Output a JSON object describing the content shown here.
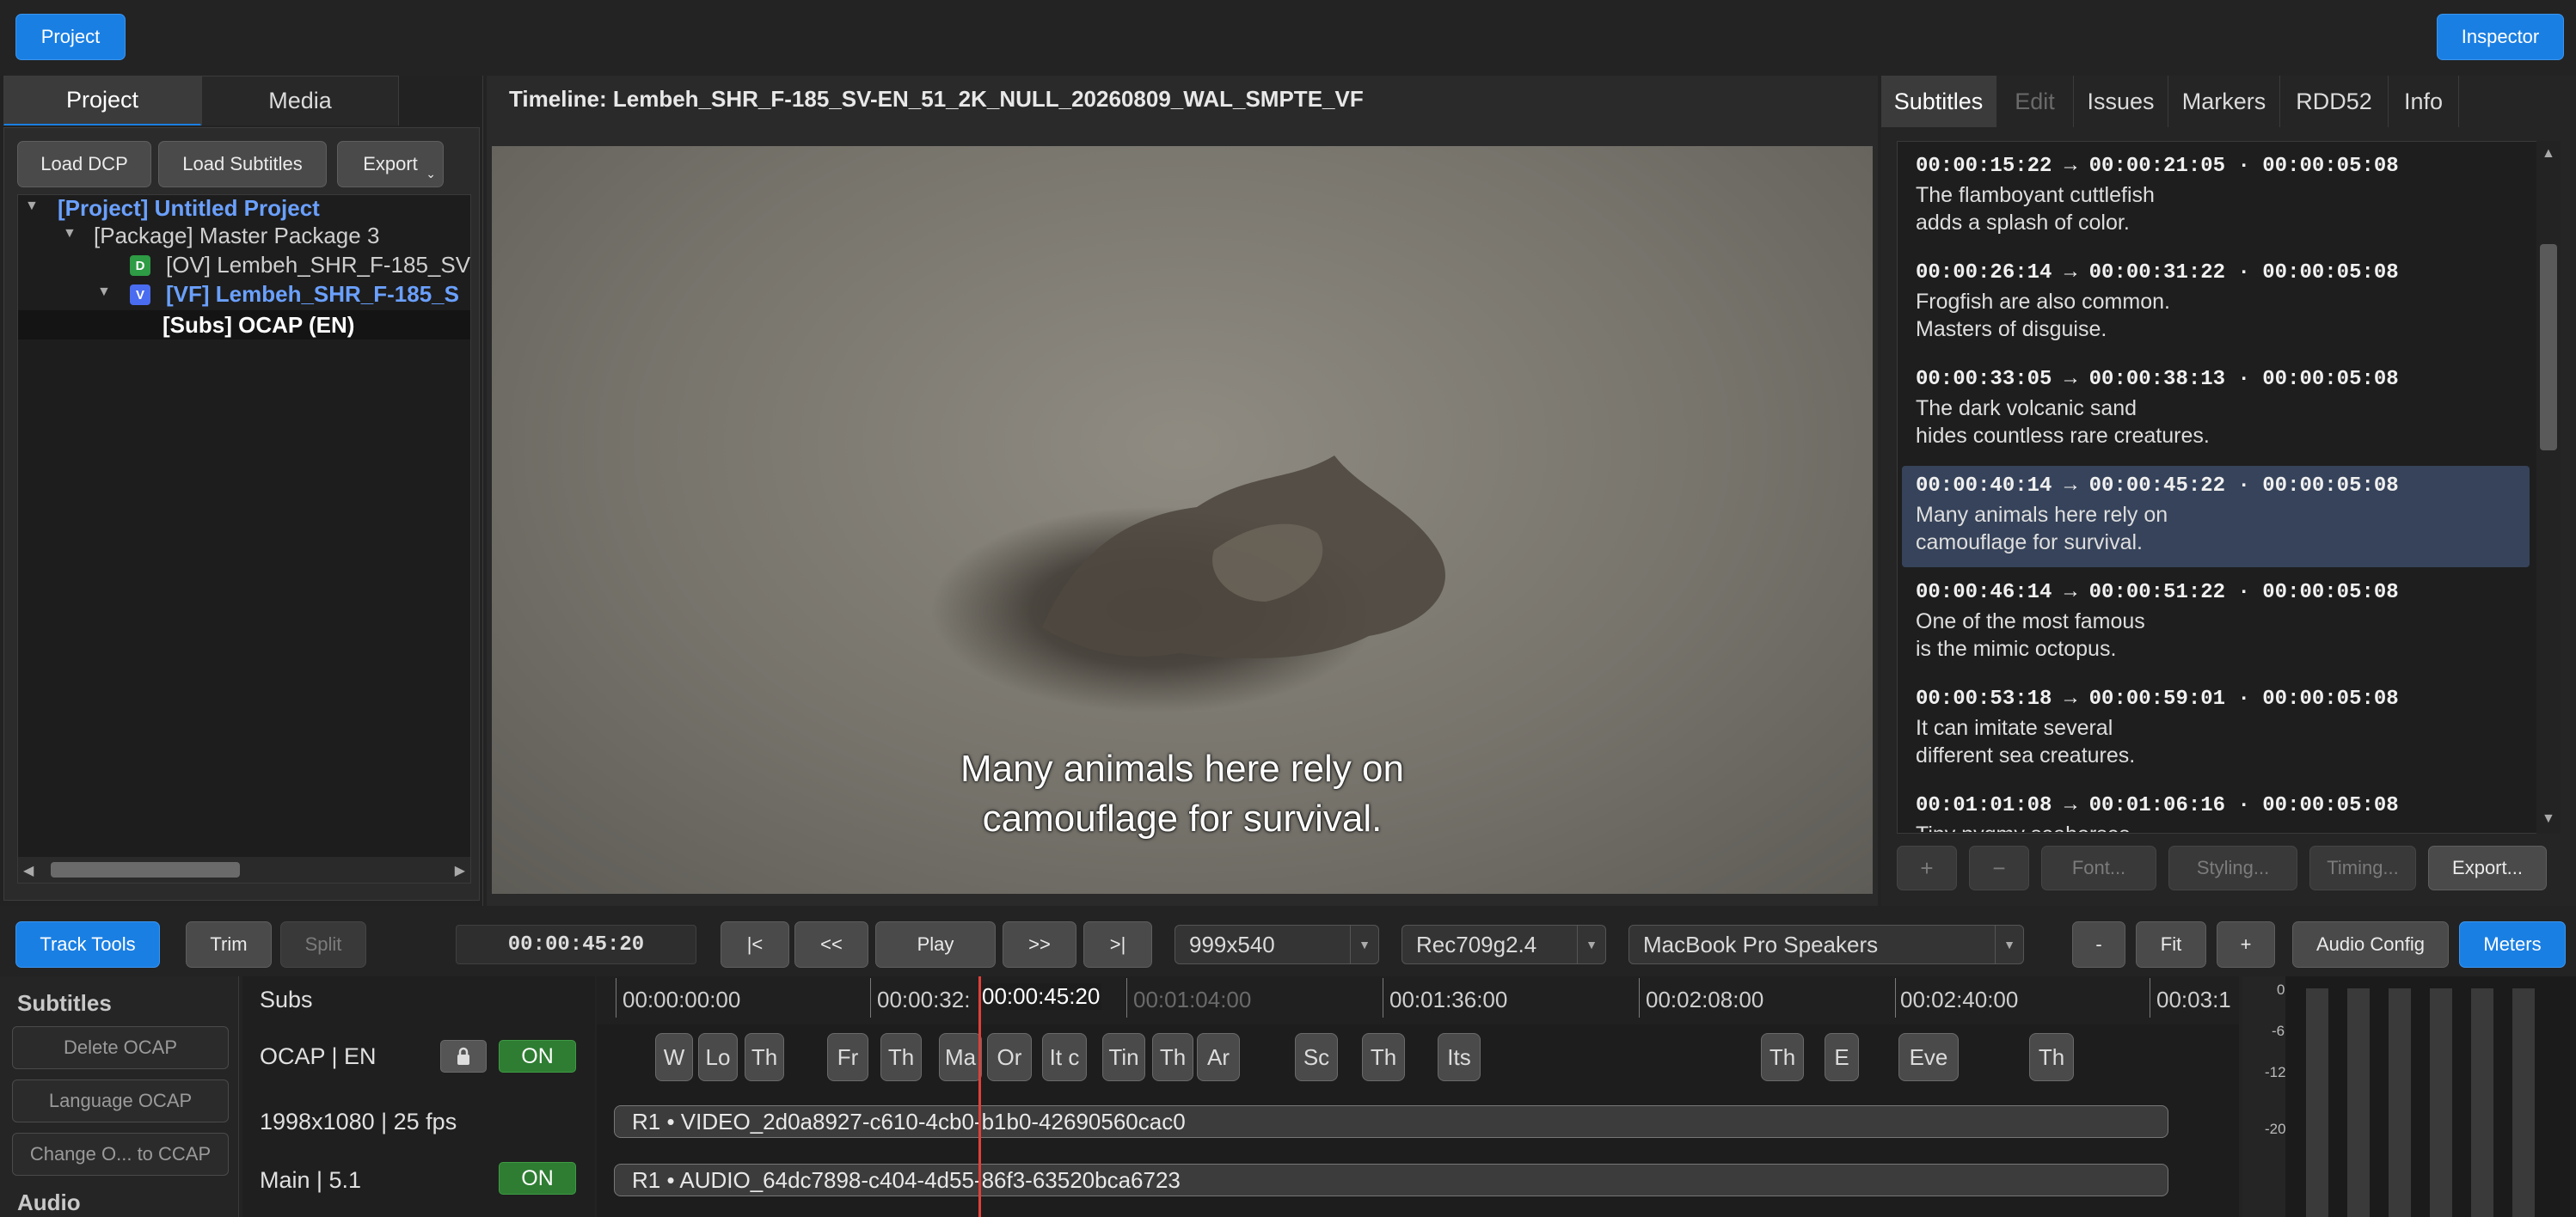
{
  "top": {
    "project_button": "Project",
    "inspector_button": "Inspector"
  },
  "left": {
    "tabs": [
      "Project",
      "Media"
    ],
    "buttons": {
      "load_dcp": "Load DCP",
      "load_subtitles": "Load Subtitles",
      "export": "Export"
    },
    "tree": [
      {
        "text": "[Project] Untitled Project"
      },
      {
        "text": "[Package] Master Package 3"
      },
      {
        "badge": "D",
        "text": "[OV] Lembeh_SHR_F-185_SV"
      },
      {
        "badge": "V",
        "text": "[VF] Lembeh_SHR_F-185_S"
      },
      {
        "text": "[Subs] OCAP (EN)"
      }
    ]
  },
  "viewer": {
    "title": "Timeline: Lembeh_SHR_F-185_SV-EN_51_2K_NULL_20260809_WAL_SMPTE_VF",
    "subtitle_line1": "Many animals here rely on",
    "subtitle_line2": "camouflage for survival."
  },
  "right": {
    "tabs": [
      "Subtitles",
      "Edit",
      "Issues",
      "Markers",
      "RDD52",
      "Info"
    ],
    "cues": [
      {
        "tc": "00:00:15:22 → 00:00:21:05 · 00:00:05:08",
        "l1": "The flamboyant cuttlefish",
        "l2": "adds a splash of color."
      },
      {
        "tc": "00:00:26:14 → 00:00:31:22 · 00:00:05:08",
        "l1": "Frogfish are also common.",
        "l2": "Masters of disguise."
      },
      {
        "tc": "00:00:33:05 → 00:00:38:13 · 00:00:05:08",
        "l1": "The dark volcanic sand",
        "l2": "hides countless rare creatures."
      },
      {
        "tc": "00:00:40:14 → 00:00:45:22 · 00:00:05:08",
        "l1": "Many animals here rely on",
        "l2": "camouflage for survival."
      },
      {
        "tc": "00:00:46:14 → 00:00:51:22 · 00:00:05:08",
        "l1": "One of the most famous",
        "l2": "is the mimic octopus."
      },
      {
        "tc": "00:00:53:18 → 00:00:59:01 · 00:00:05:08",
        "l1": "It can imitate several",
        "l2": "different sea creatures."
      },
      {
        "tc": "00:01:01:08 → 00:01:06:16 · 00:00:05:08",
        "l1": "Tiny pygmy seahorses",
        "l2": ""
      }
    ],
    "buttons": {
      "add": "+",
      "remove": "−",
      "font": "Font...",
      "styling": "Styling...",
      "timing": "Timing...",
      "export": "Export..."
    }
  },
  "transport": {
    "track_tools": "Track Tools",
    "trim": "Trim",
    "split": "Split",
    "timecode": "00:00:45:20",
    "go_start": "|<",
    "rewind": "<<",
    "play": "Play",
    "forward": ">>",
    "go_end": ">|",
    "resolution": "999x540",
    "colorspace": "Rec709g2.4",
    "audio_device": "MacBook Pro Speakers",
    "zoom_out": "-",
    "fit": "Fit",
    "zoom_in": "+",
    "audio_config": "Audio Config",
    "meters": "Meters"
  },
  "sidebar": {
    "subtitles_heading": "Subtitles",
    "delete_ocap": "Delete OCAP",
    "language_ocap": "Language OCAP",
    "change_to_ccap": "Change O... to CCAP",
    "audio_heading": "Audio"
  },
  "tracks": {
    "subs_label": "Subs",
    "ocap_label": "OCAP | EN",
    "ocap_state": "ON",
    "video_label": "1998x1080 | 25 fps",
    "audio_label": "Main | 5.1",
    "audio_state": "ON",
    "video_clip": "R1 • VIDEO_2d0a8927-c610-4cb0-b1b0-42690560cac0",
    "audio_clip": "R1 • AUDIO_64dc7898-c404-4d55-86f3-63520bca6723"
  },
  "ruler": {
    "labels": [
      "00:00:00:00",
      "00:00:32:",
      "00:01:04:00",
      "00:01:36:00",
      "00:02:08:00",
      "00:02:40:00",
      "00:03:1"
    ],
    "playhead": "00:00:45:20"
  },
  "chips": [
    "W",
    "Lo",
    "Th",
    "Fr",
    "Th",
    "Ma",
    "Or",
    "It c",
    "Tin",
    "Th",
    "Ar",
    "Sc",
    "Th",
    "Its",
    "Th",
    "E",
    "Eve",
    "Th"
  ],
  "meters": {
    "labels": [
      "0",
      "-6",
      "-12",
      "-20"
    ]
  },
  "colors": {
    "accent": "#1a7fe3",
    "on": "#2e7d32",
    "playhead": "#e0403a",
    "selected_cue": "#36435a"
  }
}
